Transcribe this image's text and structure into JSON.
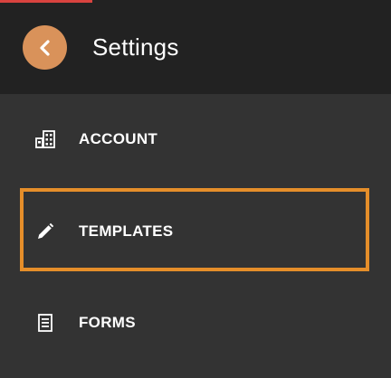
{
  "header": {
    "title": "Settings",
    "back_icon": "chevron-left-icon"
  },
  "menu": {
    "items": [
      {
        "label": "ACCOUNT",
        "icon": "building-icon"
      },
      {
        "label": "TEMPLATES",
        "icon": "pencil-icon"
      },
      {
        "label": "FORMS",
        "icon": "document-icon"
      }
    ]
  },
  "colors": {
    "header_bg": "#222222",
    "body_bg": "#333333",
    "back_button": "#d9925a",
    "highlight": "#e58e2a",
    "top_accent": "#d9433f",
    "text": "#ffffff"
  }
}
